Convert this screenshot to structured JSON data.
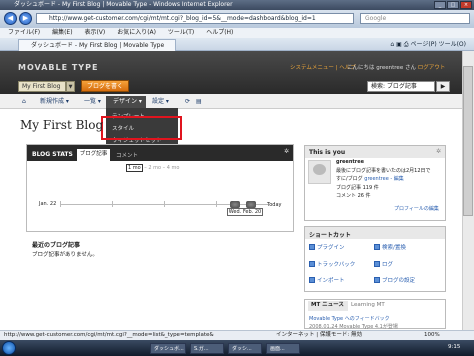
{
  "window": {
    "title": "ダッシュボード - My First Blog | Movable Type - Windows Internet Explorer"
  },
  "browser": {
    "address": "http://www.get-customer.com/cgi/mt/mt.cgi?_blog_id=5&__mode=dashboard&blog_id=1",
    "search_placeholder": "Google",
    "menu": [
      "ファイル(F)",
      "編集(E)",
      "表示(V)",
      "お気に入り(A)",
      "ツール(T)",
      "ヘルプ(H)"
    ],
    "tab_title": "ダッシュボード - My First Blog | Movable Type",
    "toolbar_page": "ページ(P)",
    "toolbar_tools": "ツール(O)"
  },
  "mt": {
    "logo": "MOVABLE TYPE",
    "system_menu": "システムメニュー",
    "help": "ヘルプ",
    "greeting": "こんにちは greentree さん",
    "logout": "ログアウト",
    "blog_selector": "My First Blog",
    "write_button": "ブログを書く",
    "search_value": "検索: ブログ記事",
    "nav": {
      "new": "新規作成",
      "list": "一覧",
      "design": "デザイン",
      "settings": "設定",
      "design_menu": [
        "テンプレート",
        "スタイル",
        "ウィジェットセット"
      ]
    },
    "page_title": "My First Blog",
    "stats": {
      "title": "BLOG STATS",
      "tab_entries": "ブログ記事",
      "tab_comments": "コメント",
      "scale_options": [
        "1 mo",
        "2 mo",
        "4 mo"
      ],
      "start_label": "Jan. 22",
      "today_label": "Today",
      "date_label": "Wed. Feb. 20"
    },
    "recent": {
      "heading": "最近のブログ記事",
      "empty": "ブログ記事がありません。"
    },
    "profile": {
      "heading": "This is you",
      "name": "greentree",
      "line1": "最後にブログ記事を書いたのは2月12日で",
      "line2": "すに/ブログ",
      "edit_inline": "greentree - 編集",
      "entries_label": "ブログ記事 119 件",
      "comments_label": "コメント 26 件",
      "edit_profile": "プロフィールの編集"
    },
    "shortcuts": {
      "heading": "ショートカット",
      "items": [
        "プラグイン",
        "検索/置換",
        "トラックバック",
        "ログ",
        "インポート",
        "ブログの設定"
      ]
    },
    "news": {
      "tab1": "MT ニュース",
      "tab2": "Learning MT",
      "item1": "Movable Type へのフィードバック",
      "item2": "2008.01.24 Movable Type 4.1が登場"
    }
  },
  "status": {
    "url": "http://www.get-customer.com/cgi/mt/mt.cgi?__mode=list&_type=template&",
    "zone": "インターネット | 保護モード: 無効",
    "zoom": "100%"
  },
  "taskbar": {
    "tasks": [
      "ダッシュボ...",
      "S.ガ...",
      "ダッシ...",
      "画面..."
    ],
    "clock": "9:15"
  },
  "colors": {
    "mt_header": "#2a2a2a",
    "write_button": "#e8851a",
    "highlight": "#e0141e"
  }
}
